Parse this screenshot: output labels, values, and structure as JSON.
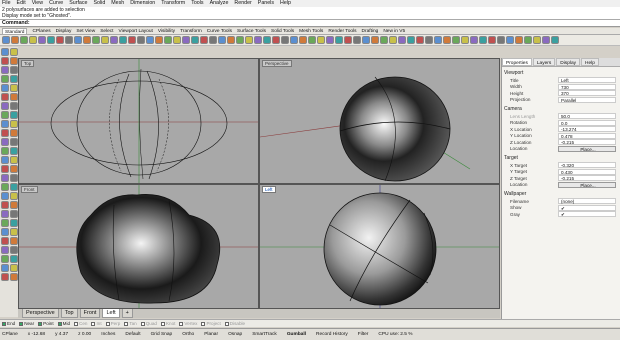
{
  "menu": [
    "File",
    "Edit",
    "View",
    "Curve",
    "Surface",
    "Solid",
    "Mesh",
    "Dimension",
    "Transform",
    "Tools",
    "Analyze",
    "Render",
    "Panels",
    "Help"
  ],
  "command_history": [
    "2 polysurfaces are added to selection",
    "Display mode set to \"Ghosted\"."
  ],
  "command_prompt": "Command:",
  "toolbar_tabs": [
    "Standard",
    "CPlanes",
    "Display",
    "Set View",
    "Select",
    "Viewport Layout",
    "Visibility",
    "Transform",
    "Curve Tools",
    "Surface Tools",
    "Solid Tools",
    "Mesh Tools",
    "Render Tools",
    "Drafting",
    "New in V5"
  ],
  "viewports": {
    "top": "Top",
    "perspective": "Perspective",
    "front": "Front",
    "left": "Left"
  },
  "viewport_tabs": [
    "Perspective",
    "Top",
    "Front",
    "Left",
    "+"
  ],
  "osnap": [
    {
      "label": "End",
      "on": true
    },
    {
      "label": "Near",
      "on": true
    },
    {
      "label": "Point",
      "on": true
    },
    {
      "label": "Mid",
      "on": true
    },
    {
      "label": "Cen",
      "on": false
    },
    {
      "label": "Int",
      "on": false
    },
    {
      "label": "Perp",
      "on": false
    },
    {
      "label": "Tan",
      "on": false
    },
    {
      "label": "Quad",
      "on": false
    },
    {
      "label": "Knot",
      "on": false
    },
    {
      "label": "Vertex",
      "on": false
    },
    {
      "label": "Project",
      "on": false
    },
    {
      "label": "Disable",
      "on": false
    }
  ],
  "status": {
    "cplane": "CPlane",
    "x": "x -12.68",
    "y": "y 4.37",
    "z": "z 0.00",
    "units": "Inches",
    "layer": "Default",
    "grid_snap": "Grid Snap",
    "ortho": "Ortho",
    "planar": "Planar",
    "osnap": "Osnap",
    "smarttrack": "SmartTrack",
    "gumball": "Gumball",
    "record_history": "Record History",
    "filter": "Filter",
    "cpu": "CPU use: 2.5 %"
  },
  "panel": {
    "tabs": [
      "Properties",
      "Layers",
      "Display",
      "Help"
    ],
    "viewport_header": "Viewport",
    "viewport_rows": [
      {
        "label": "Title",
        "value": "Left"
      },
      {
        "label": "Width",
        "value": "730"
      },
      {
        "label": "Height",
        "value": "370"
      },
      {
        "label": "Projection",
        "value": "Parallel"
      }
    ],
    "camera_header": "Camera",
    "camera_rows": [
      {
        "label": "Lens Length",
        "value": "50.0",
        "dim": true
      },
      {
        "label": "Rotation",
        "value": "0.0"
      },
      {
        "label": "X Location",
        "value": "-13.274"
      },
      {
        "label": "Y Location",
        "value": "0.478"
      },
      {
        "label": "Z Location",
        "value": "-0.215"
      },
      {
        "label": "Location",
        "value": "Place...",
        "button": true
      }
    ],
    "target_header": "Target",
    "target_rows": [
      {
        "label": "X Target",
        "value": "-0.320"
      },
      {
        "label": "Y Target",
        "value": "0.430"
      },
      {
        "label": "Z Target",
        "value": "-0.215"
      },
      {
        "label": "Location",
        "value": "Place...",
        "button": true
      }
    ],
    "wallpaper_header": "Wallpaper",
    "wallpaper_rows": [
      {
        "label": "Filename",
        "value": "(none)"
      },
      {
        "label": "Show",
        "value": "✔"
      },
      {
        "label": "Gray",
        "value": "✔"
      }
    ]
  }
}
